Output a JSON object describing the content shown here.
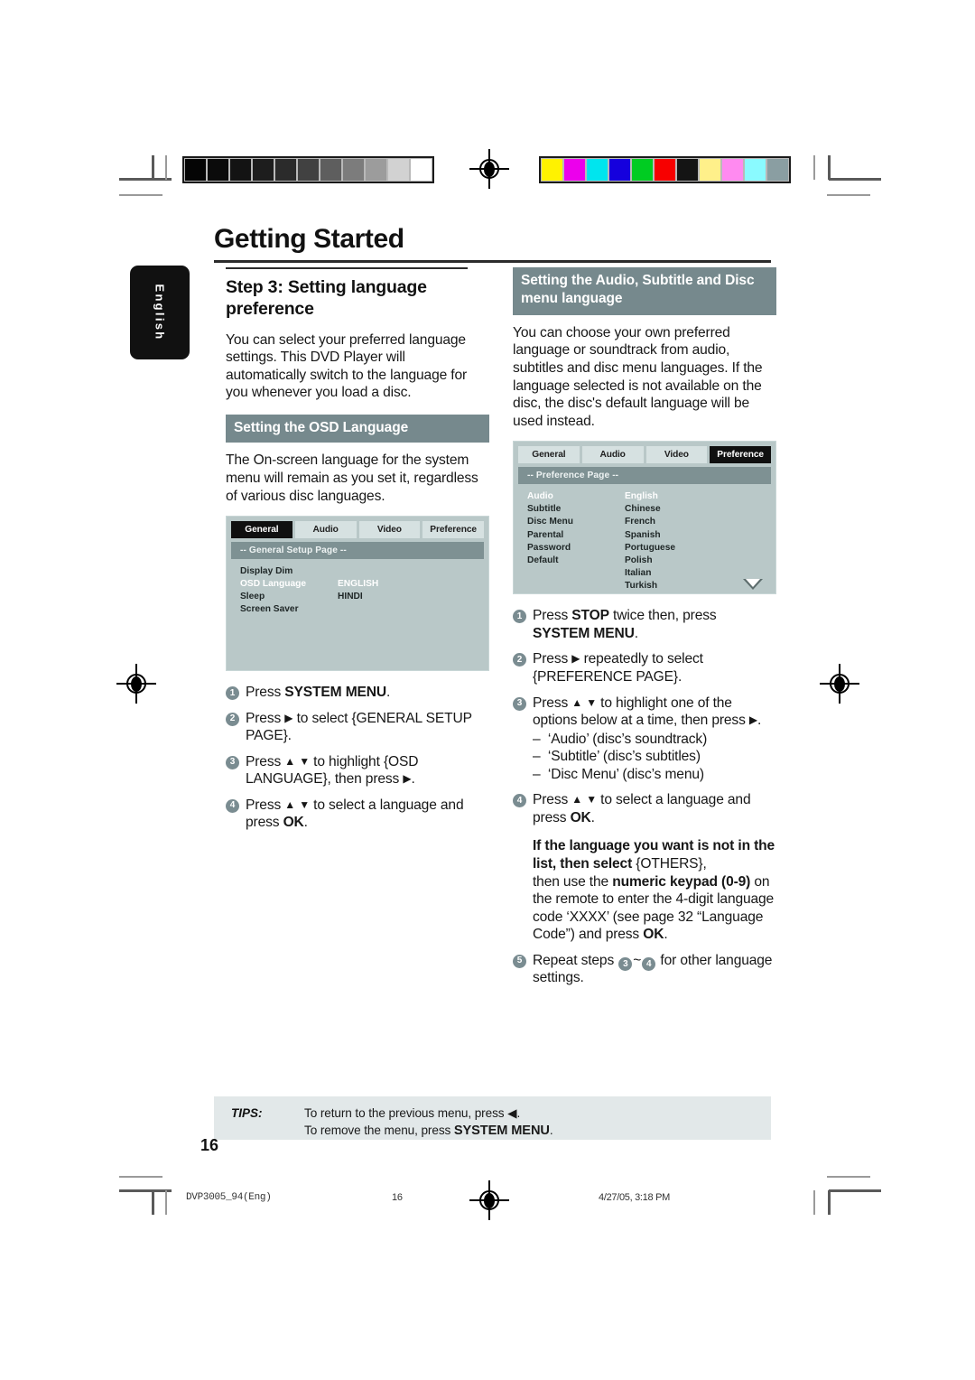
{
  "document": {
    "title": "Getting Started",
    "side_tab": "English",
    "page_number": "16"
  },
  "calibration": {
    "grayscale_label": "grayscale-strip",
    "gray_swatches": [
      "#050505",
      "#0b0b0b",
      "#131313",
      "#1d1d1d",
      "#2b2b2b",
      "#414141",
      "#5e5e5e",
      "#7c7c7c",
      "#9c9c9c",
      "#d2d2d2",
      "#ffffff"
    ],
    "color_swatches": [
      "#fff200",
      "#ec00ec",
      "#00e5ee",
      "#1500dd",
      "#00cc22",
      "#f70000",
      "#141414",
      "#fff08a",
      "#ff8af0",
      "#8afaff",
      "#8a9ea2"
    ]
  },
  "left_column": {
    "heading": "Step 3:  Setting language preference",
    "intro": "You can select your preferred language settings. This DVD Player will automatically switch to the language for you whenever you load a disc.",
    "banner": "Setting the OSD Language",
    "paragraph": "The On-screen language for the system menu will remain as you set it, regardless of various disc languages.",
    "osd": {
      "tabs": [
        "General",
        "Audio",
        "Video",
        "Preference"
      ],
      "active_tab": "General",
      "page_bar": "--  General Setup Page  --",
      "rows": [
        {
          "key": "Display Dim",
          "value": "",
          "highlight": false
        },
        {
          "key": "OSD Language",
          "value": "ENGLISH",
          "highlight": true
        },
        {
          "key": "Sleep",
          "value": "HINDI",
          "highlight": false
        },
        {
          "key": "Screen Saver",
          "value": "",
          "highlight": false
        }
      ]
    },
    "steps": [
      {
        "num": "1",
        "html": "Press <b>SYSTEM MENU</b>."
      },
      {
        "num": "2",
        "html": "Press <span class=\"tri-r\">&#9654;</span> to select {GENERAL SETUP PAGE}."
      },
      {
        "num": "3",
        "html": "Press <span class=\"tri-r\">&#9650;</span> <span class=\"tri-r\">&#9660;</span> to highlight {OSD LANGUAGE}, then press <span class=\"tri-r\">&#9654;</span>."
      },
      {
        "num": "4",
        "html": "Press <span class=\"tri-r\">&#9650;</span> <span class=\"tri-r\">&#9660;</span> to select a language and press <b>OK</b>."
      }
    ]
  },
  "right_column": {
    "banner": "Setting the Audio, Subtitle and Disc menu language",
    "intro": "You can choose your own preferred language or soundtrack from audio, subtitles and disc menu languages. If the language selected is not available on the disc, the disc's default language will be used instead.",
    "osd": {
      "tabs": [
        "General",
        "Audio",
        "Video",
        "Preference"
      ],
      "active_tab": "Preference",
      "page_bar": "--  Preference Page  --",
      "rows": [
        {
          "key": "Audio",
          "value": "English",
          "highlight": true
        },
        {
          "key": "Subtitle",
          "value": "Chinese",
          "highlight": false
        },
        {
          "key": "Disc Menu",
          "value": "French",
          "highlight": false
        },
        {
          "key": "Parental",
          "value": "Spanish",
          "highlight": false
        },
        {
          "key": "Password",
          "value": "Portuguese",
          "highlight": false
        },
        {
          "key": "Default",
          "value": "Polish",
          "highlight": false
        },
        {
          "key": "",
          "value": "Italian",
          "highlight": false
        },
        {
          "key": "",
          "value": "Turkish",
          "highlight": false
        }
      ],
      "scroll_arrow": "scroll-down-arrow"
    },
    "steps": [
      {
        "num": "1",
        "html": "Press <b>STOP</b> twice then, press <b>SYSTEM MENU</b>."
      },
      {
        "num": "2",
        "html": "Press <span class=\"tri-r\">&#9654;</span> repeatedly to select {PREFERENCE PAGE}."
      },
      {
        "num": "3",
        "html": "Press <span class=\"tri-r\">&#9650;</span> <span class=\"tri-r\">&#9660;</span> to highlight one of the options below at a time, then press <span class=\"tri-r\">&#9654;</span>.<div class=\"dashlist\"><div>&#8211;&nbsp; &#8216;Audio&#8217; (disc&#8217;s soundtrack)</div><div>&#8211;&nbsp; &#8216;Subtitle&#8217; (disc&#8217;s subtitles)</div><div>&#8211;&nbsp; &#8216;Disc Menu&#8217; (disc&#8217;s menu)</div></div>"
      },
      {
        "num": "4",
        "html": "Press <span class=\"tri-r\">&#9650;</span> <span class=\"tri-r\">&#9660;</span> to select a language and press <b>OK</b>.<div style=\"margin-top:12px\"><b>If the language you want is not in the list, then select</b> {OTHERS},<br>then use the <b>numeric keypad (0-9)</b> on the remote to enter the 4-digit language code &#8216;XXXX&#8217; (see page 32 &#8220;Language Code&#8221;) and press <b>OK</b>.</div>"
      },
      {
        "num": "5",
        "html": "Repeat steps <span class=\"numbadge inline\">3</span>~<span class=\"numbadge inline\">4</span> for other language settings."
      }
    ]
  },
  "tips": {
    "label": "TIPS:",
    "line1_pre": "To return to the previous menu, press ",
    "line1_icon": "&#9664;",
    "line1_post": ".",
    "line2_pre": "To remove the menu, press ",
    "line2_bold": "SYSTEM MENU",
    "line2_post": "."
  },
  "footer": {
    "file": "DVP3005_94(Eng)",
    "page": "16",
    "timestamp": "4/27/05, 3:18 PM"
  }
}
